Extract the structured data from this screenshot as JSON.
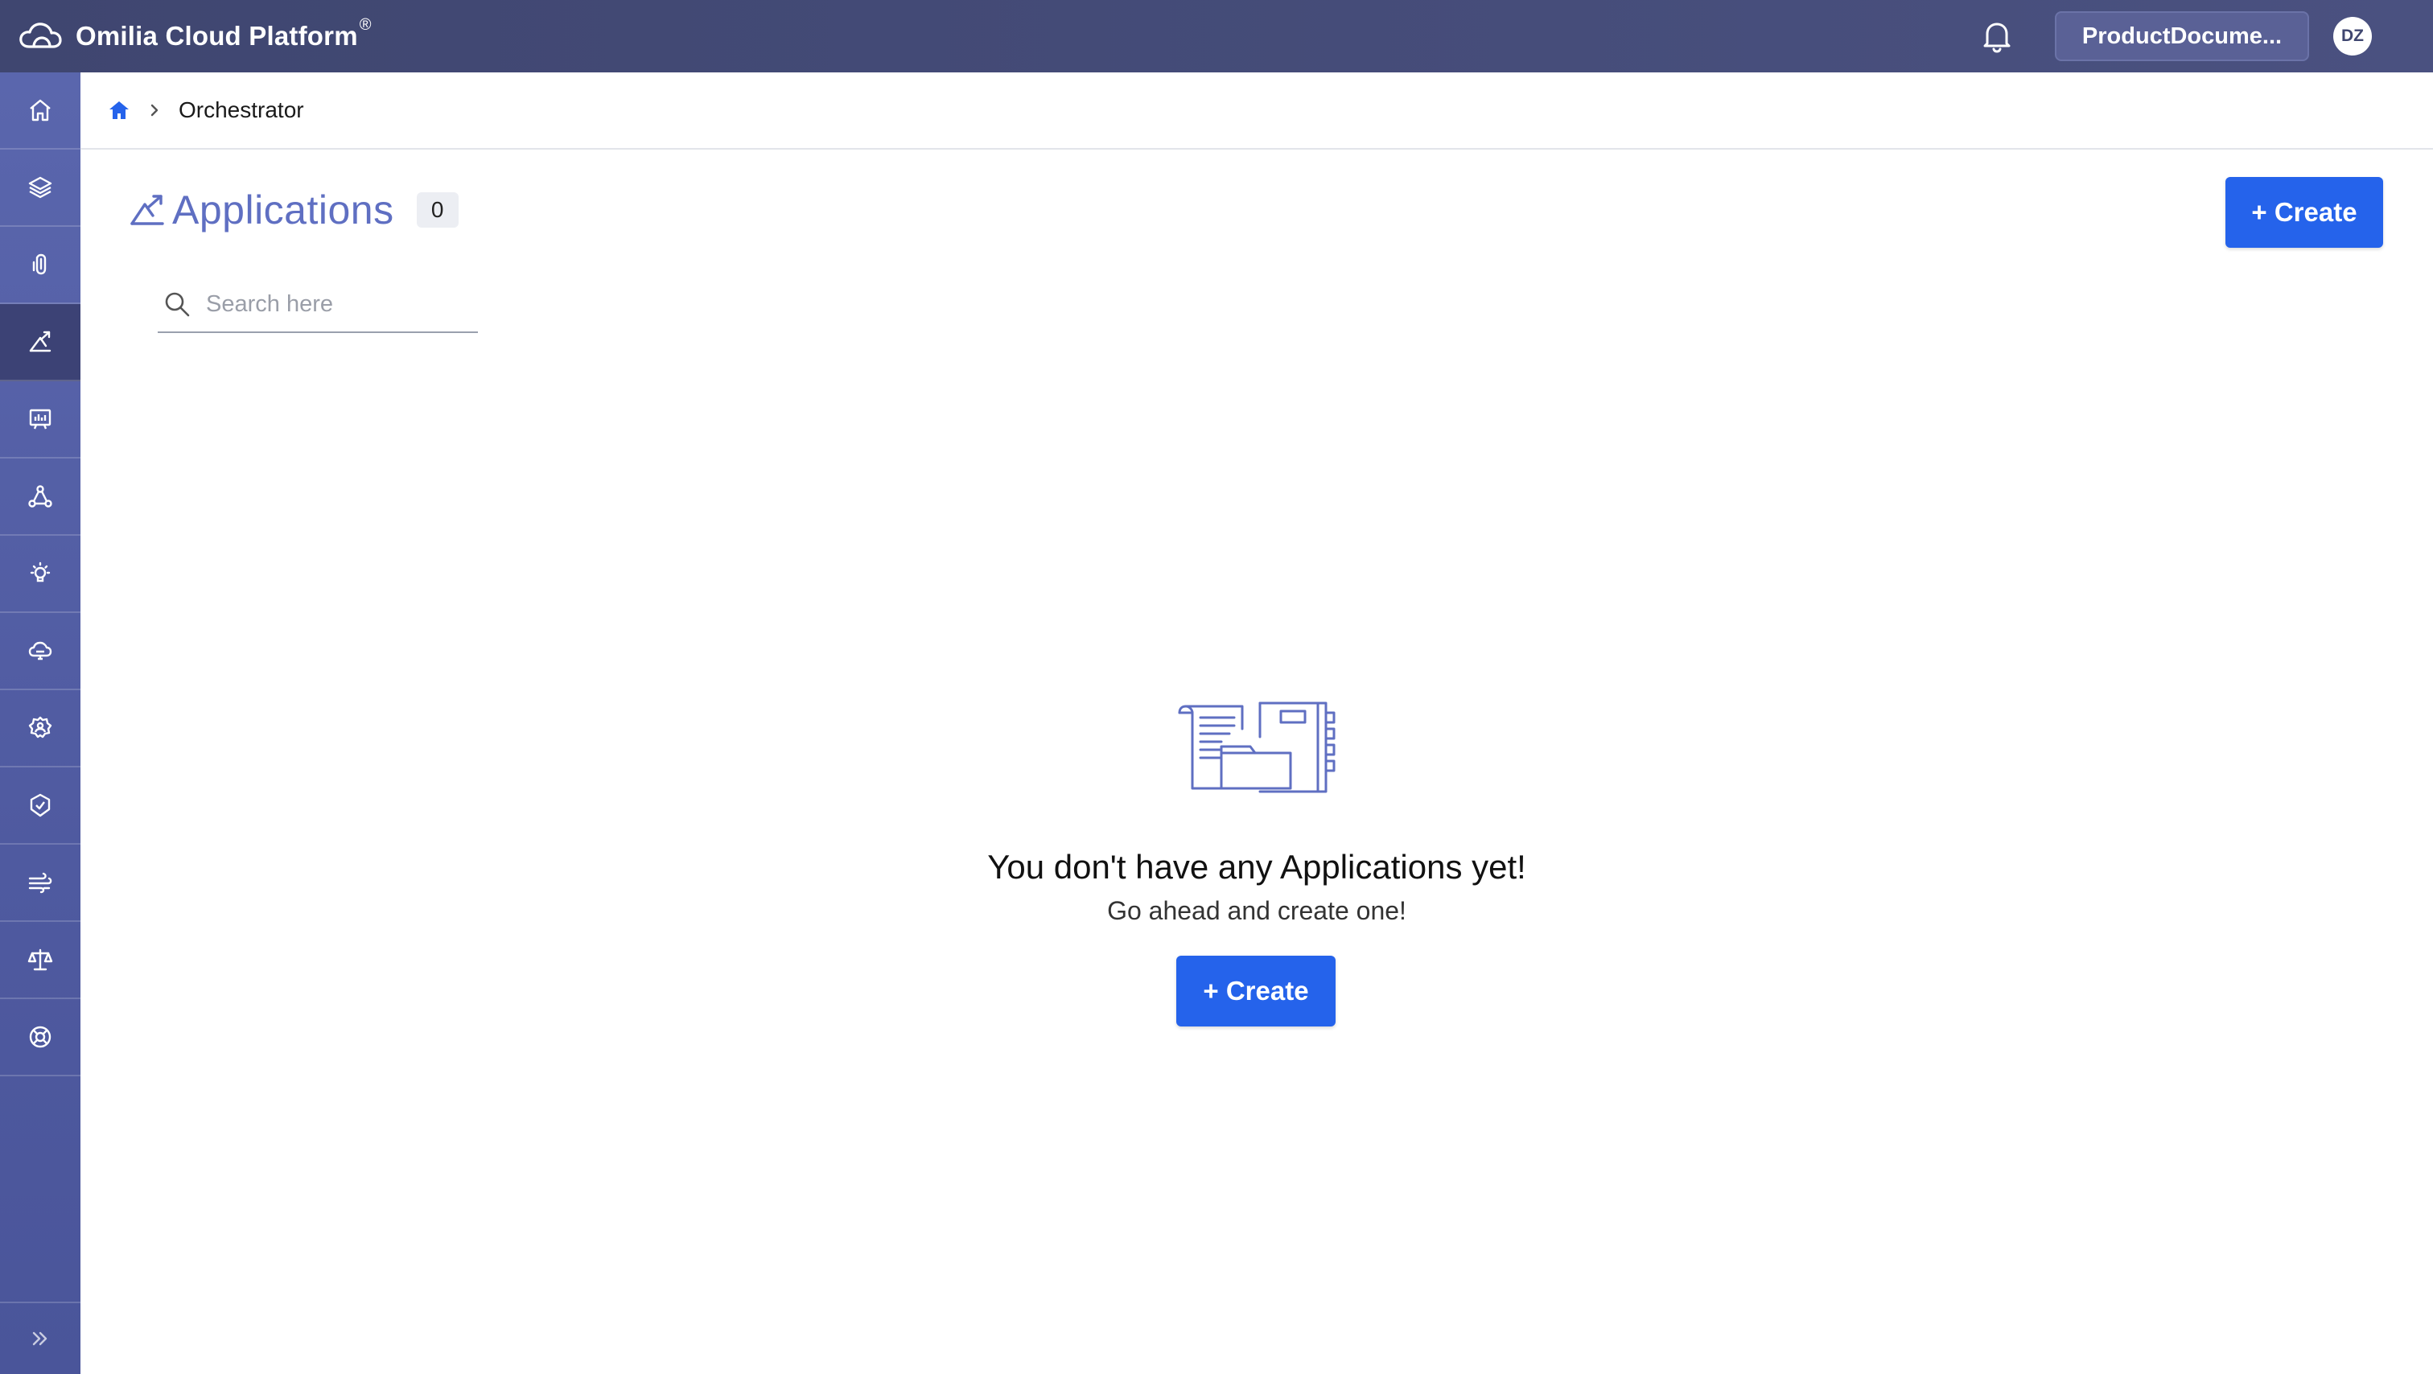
{
  "app": {
    "brand": "Omilia Cloud Platform",
    "brand_mark": "®",
    "org_name": "ProductDocume...",
    "user_initials": "DZ"
  },
  "sidebar": {
    "items": [
      {
        "icon": "home-icon",
        "active": false
      },
      {
        "icon": "layers-icon",
        "active": false
      },
      {
        "icon": "clip-icon",
        "active": false
      },
      {
        "icon": "orchestrator-icon",
        "active": true
      },
      {
        "icon": "analytics-icon",
        "active": false
      },
      {
        "icon": "network-icon",
        "active": false
      },
      {
        "icon": "bulb-icon",
        "active": false
      },
      {
        "icon": "cloud-icon",
        "active": false
      },
      {
        "icon": "user-settings-icon",
        "active": false
      },
      {
        "icon": "shield-gear-icon",
        "active": false
      },
      {
        "icon": "wind-icon",
        "active": false
      },
      {
        "icon": "scale-icon",
        "active": false
      },
      {
        "icon": "lifebuoy-icon",
        "active": false
      }
    ],
    "expand_icon": "double-chevron-right-icon"
  },
  "breadcrumb": {
    "current": "Orchestrator"
  },
  "page": {
    "title": "Applications",
    "count": "0",
    "create_label": "+ Create",
    "search_placeholder": "Search here"
  },
  "empty_state": {
    "title": "You don't have any Applications yet!",
    "subtitle": "Go ahead and create one!",
    "create_label": "+ Create"
  },
  "colors": {
    "topbar": "#434a78",
    "sidebar": "#5561a8",
    "accent": "#2563eb",
    "title": "#5f6fc2"
  }
}
